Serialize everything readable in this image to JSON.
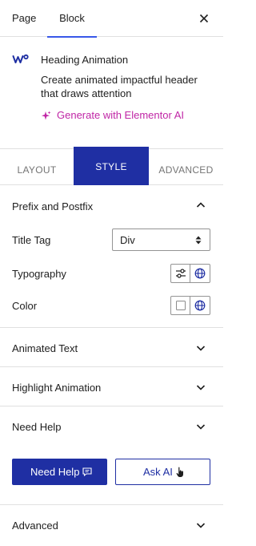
{
  "top_tabs": {
    "page": "Page",
    "block": "Block"
  },
  "block": {
    "name": "Heading Animation",
    "description": "Create animated impactful header that draws attention",
    "ai_link": "Generate with Elementor AI"
  },
  "style_tabs": {
    "layout": "LAYOUT",
    "style": "STYLE",
    "advanced": "ADVANCED",
    "active": "STYLE"
  },
  "sections": {
    "prefix_postfix": "Prefix and Postfix",
    "animated_text": "Animated Text",
    "highlight_animation": "Highlight Animation",
    "need_help": "Need Help",
    "advanced": "Advanced"
  },
  "controls": {
    "title_tag_label": "Title Tag",
    "title_tag_value": "Div",
    "typography_label": "Typography",
    "color_label": "Color"
  },
  "buttons": {
    "need_help": "Need Help",
    "ask_ai": "Ask AI"
  },
  "colors": {
    "primary": "#1f2fa3",
    "ai_accent": "#c026a6",
    "tab_underline": "#3858e9"
  },
  "icons": {
    "close": "close-icon",
    "block": "heading-animation-icon",
    "ai": "sparkle-icon",
    "chevron_up": "chevron-up-icon",
    "chevron_down": "chevron-down-icon",
    "select_arrows": "sort-arrows-icon",
    "typography_settings": "settings-sliders-icon",
    "globe": "globe-icon",
    "color_swatch": "color-swatch-icon",
    "chat": "chat-icon",
    "hand": "hand-pointer-icon"
  }
}
